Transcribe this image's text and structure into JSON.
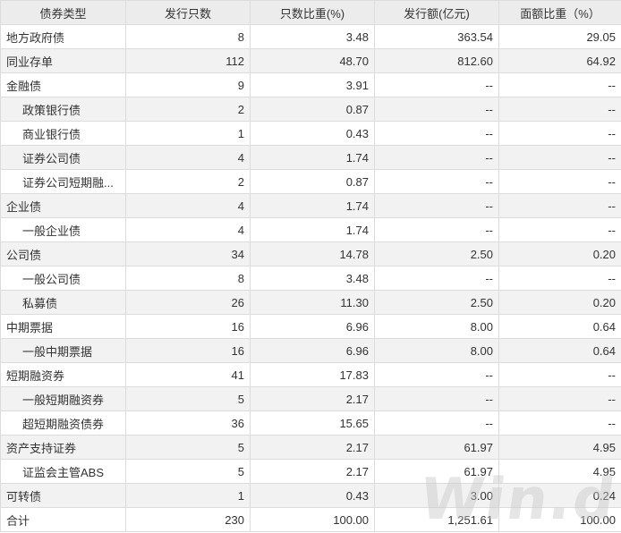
{
  "headers": [
    "债券类型",
    "发行只数",
    "只数比重(%)",
    "发行额(亿元)",
    "面额比重（%）"
  ],
  "rows": [
    {
      "name": "地方政府债",
      "indent": false,
      "count": "8",
      "count_pct": "3.48",
      "amount": "363.54",
      "amount_pct": "29.05"
    },
    {
      "name": "同业存单",
      "indent": false,
      "count": "112",
      "count_pct": "48.70",
      "amount": "812.60",
      "amount_pct": "64.92"
    },
    {
      "name": "金融债",
      "indent": false,
      "count": "9",
      "count_pct": "3.91",
      "amount": "--",
      "amount_pct": "--"
    },
    {
      "name": "政策银行债",
      "indent": true,
      "count": "2",
      "count_pct": "0.87",
      "amount": "--",
      "amount_pct": "--"
    },
    {
      "name": "商业银行债",
      "indent": true,
      "count": "1",
      "count_pct": "0.43",
      "amount": "--",
      "amount_pct": "--"
    },
    {
      "name": "证券公司债",
      "indent": true,
      "count": "4",
      "count_pct": "1.74",
      "amount": "--",
      "amount_pct": "--"
    },
    {
      "name": "证券公司短期融...",
      "indent": true,
      "count": "2",
      "count_pct": "0.87",
      "amount": "--",
      "amount_pct": "--"
    },
    {
      "name": "企业债",
      "indent": false,
      "count": "4",
      "count_pct": "1.74",
      "amount": "--",
      "amount_pct": "--"
    },
    {
      "name": "一般企业债",
      "indent": true,
      "count": "4",
      "count_pct": "1.74",
      "amount": "--",
      "amount_pct": "--"
    },
    {
      "name": "公司债",
      "indent": false,
      "count": "34",
      "count_pct": "14.78",
      "amount": "2.50",
      "amount_pct": "0.20"
    },
    {
      "name": "一般公司债",
      "indent": true,
      "count": "8",
      "count_pct": "3.48",
      "amount": "--",
      "amount_pct": "--"
    },
    {
      "name": "私募债",
      "indent": true,
      "count": "26",
      "count_pct": "11.30",
      "amount": "2.50",
      "amount_pct": "0.20"
    },
    {
      "name": "中期票据",
      "indent": false,
      "count": "16",
      "count_pct": "6.96",
      "amount": "8.00",
      "amount_pct": "0.64"
    },
    {
      "name": "一般中期票据",
      "indent": true,
      "count": "16",
      "count_pct": "6.96",
      "amount": "8.00",
      "amount_pct": "0.64"
    },
    {
      "name": "短期融资券",
      "indent": false,
      "count": "41",
      "count_pct": "17.83",
      "amount": "--",
      "amount_pct": "--"
    },
    {
      "name": "一般短期融资券",
      "indent": true,
      "count": "5",
      "count_pct": "2.17",
      "amount": "--",
      "amount_pct": "--"
    },
    {
      "name": "超短期融资债券",
      "indent": true,
      "count": "36",
      "count_pct": "15.65",
      "amount": "--",
      "amount_pct": "--"
    },
    {
      "name": "资产支持证券",
      "indent": false,
      "count": "5",
      "count_pct": "2.17",
      "amount": "61.97",
      "amount_pct": "4.95"
    },
    {
      "name": "证监会主管ABS",
      "indent": true,
      "count": "5",
      "count_pct": "2.17",
      "amount": "61.97",
      "amount_pct": "4.95"
    },
    {
      "name": "可转债",
      "indent": false,
      "count": "1",
      "count_pct": "0.43",
      "amount": "3.00",
      "amount_pct": "0.24"
    },
    {
      "name": "合计",
      "indent": false,
      "count": "230",
      "count_pct": "100.00",
      "amount": "1,251.61",
      "amount_pct": "100.00"
    }
  ],
  "watermark": "Win.d"
}
